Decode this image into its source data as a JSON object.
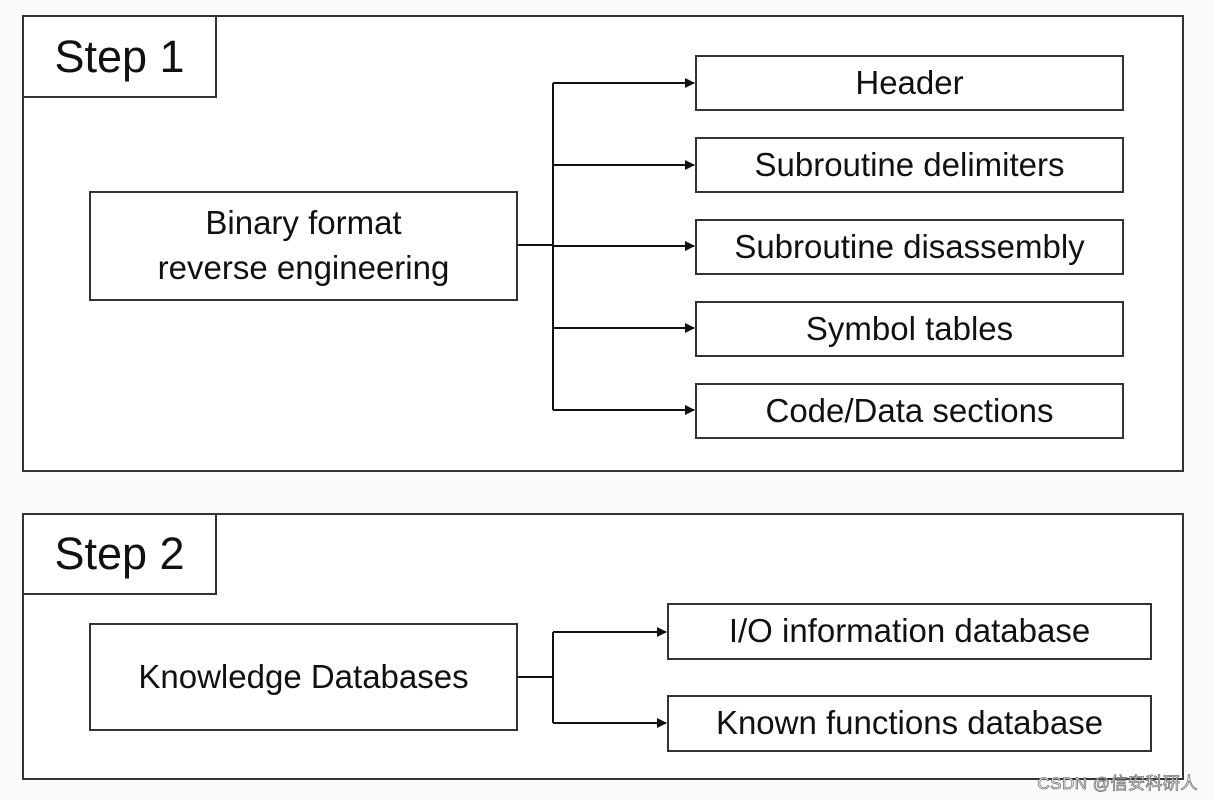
{
  "step1": {
    "label": "Step 1",
    "source": [
      "Binary format",
      "reverse engineering"
    ],
    "targets": [
      "Header",
      "Subroutine delimiters",
      "Subroutine disassembly",
      "Symbol tables",
      "Code/Data sections"
    ]
  },
  "step2": {
    "label": "Step 2",
    "source": "Knowledge Databases",
    "targets": [
      "I/O information database",
      "Known functions database"
    ]
  },
  "watermark": "CSDN @信安科研人"
}
